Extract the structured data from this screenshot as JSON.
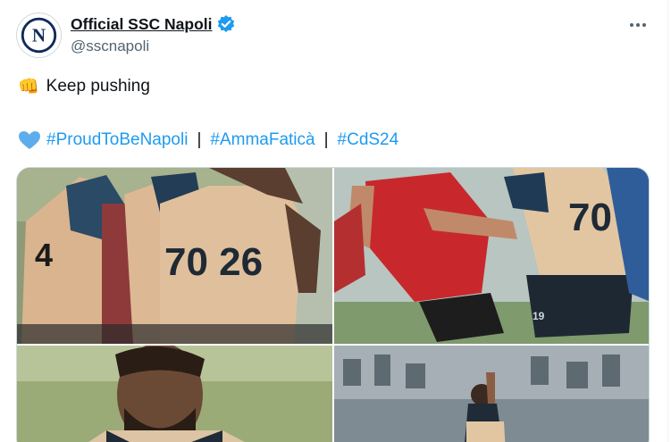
{
  "author": {
    "display_name": "Official SSC Napoli",
    "handle": "@sscnapoli",
    "avatar_letter": "N",
    "verified": true
  },
  "tweet": {
    "line1_emoji": "👊",
    "line1_text": "Keep pushing",
    "line2_emoji_icon": "blue-heart-icon",
    "hashtags": [
      "#ProudToBeNapoli",
      "#AmmaFaticà",
      "#CdS24"
    ],
    "separator": "|"
  },
  "media": {
    "tile1": {
      "jersey_numbers": "70 26",
      "jersey_left_partial": "4"
    },
    "tile2": {
      "jersey_number": "70",
      "shorts_number": "19"
    }
  },
  "colors": {
    "accent": "#1d9bf0",
    "text_primary": "#0f1419",
    "text_secondary": "#536471",
    "verified": "#1d9bf0"
  },
  "icons": [
    "verified-badge-icon",
    "more-options-icon",
    "fist-icon",
    "blue-heart-icon"
  ]
}
